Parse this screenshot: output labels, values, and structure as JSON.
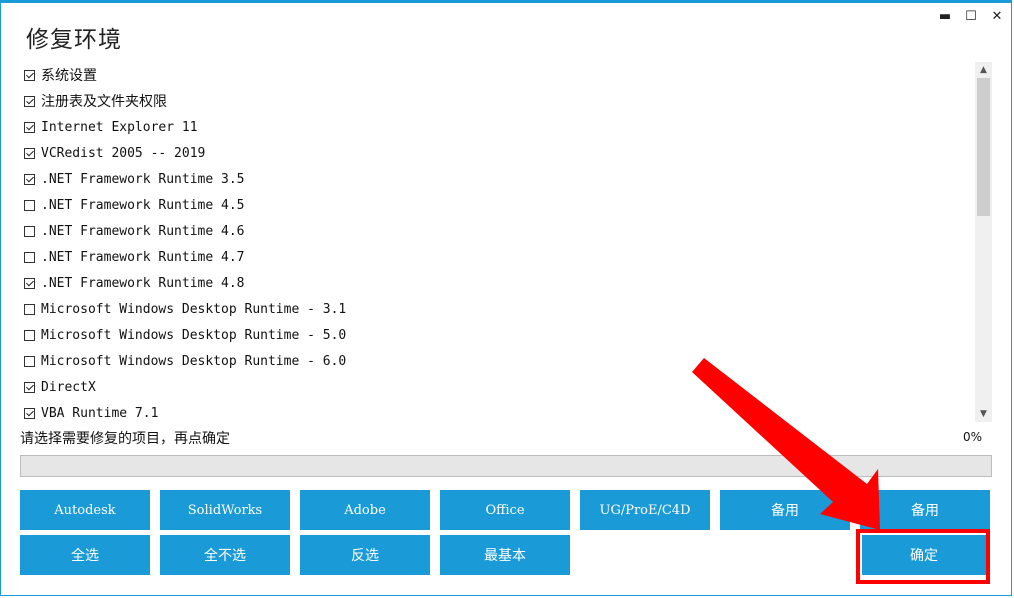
{
  "window": {
    "title": "修复环境",
    "controls": {
      "minimize": "▬",
      "maximize": "☐",
      "close": "✕"
    }
  },
  "items": [
    {
      "label": "系统设置",
      "checked": true
    },
    {
      "label": "注册表及文件夹权限",
      "checked": true
    },
    {
      "label": "Internet Explorer 11",
      "checked": true
    },
    {
      "label": "VCRedist 2005 -- 2019",
      "checked": true
    },
    {
      "label": ".NET Framework Runtime 3.5",
      "checked": true
    },
    {
      "label": ".NET Framework Runtime 4.5",
      "checked": false
    },
    {
      "label": ".NET Framework Runtime 4.6",
      "checked": false
    },
    {
      "label": ".NET Framework Runtime 4.7",
      "checked": false
    },
    {
      "label": ".NET Framework Runtime 4.8",
      "checked": true
    },
    {
      "label": "Microsoft Windows Desktop Runtime - 3.1",
      "checked": false
    },
    {
      "label": "Microsoft Windows Desktop Runtime - 5.0",
      "checked": false
    },
    {
      "label": "Microsoft Windows Desktop Runtime - 6.0",
      "checked": false
    },
    {
      "label": "DirectX",
      "checked": true
    },
    {
      "label": "VBA Runtime 7.1",
      "checked": true
    }
  ],
  "status": {
    "message": "请选择需要修复的项目，再点确定",
    "percent_text": "0%",
    "progress": 0
  },
  "buttons_row1": [
    "Autodesk",
    "SolidWorks",
    "Adobe",
    "Office",
    "UG/ProE/C4D",
    "备用",
    "备用"
  ],
  "buttons_row2": [
    "全选",
    "全不选",
    "反选",
    "最基本"
  ],
  "confirm_button": "确定",
  "colors": {
    "accent": "#1a9ad6",
    "annotation": "#ff0000"
  }
}
